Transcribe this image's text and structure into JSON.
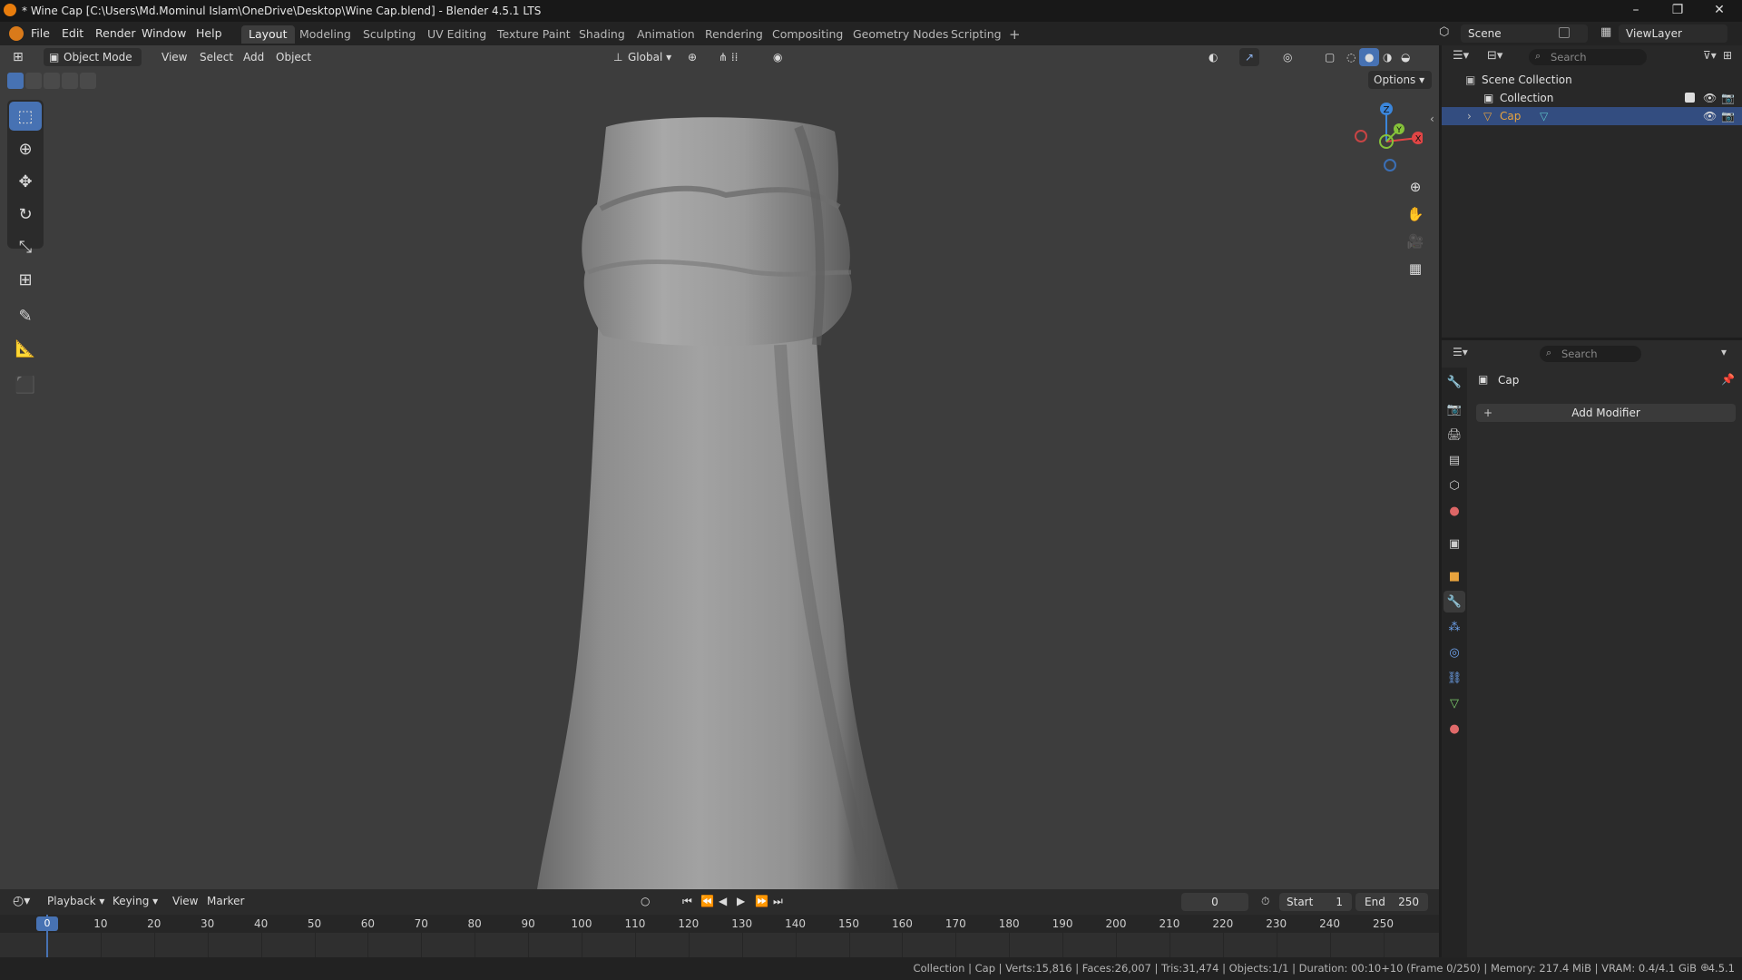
{
  "window": {
    "title": "* Wine Cap [C:\\Users\\Md.Mominul Islam\\OneDrive\\Desktop\\Wine Cap.blend] - Blender 4.5.1 LTS",
    "minimize": "–",
    "maximize": "❐",
    "close": "✕"
  },
  "menu": [
    "File",
    "Edit",
    "Render",
    "Window",
    "Help"
  ],
  "workspaces": [
    "Layout",
    "Modeling",
    "Sculpting",
    "UV Editing",
    "Texture Paint",
    "Shading",
    "Animation",
    "Rendering",
    "Compositing",
    "Geometry Nodes",
    "Scripting"
  ],
  "workspace_add": "+",
  "scene": {
    "label": "Scene",
    "view_layer": "ViewLayer"
  },
  "viewport": {
    "mode": "Object Mode",
    "menus": [
      "View",
      "Select",
      "Add",
      "Object"
    ],
    "orientation": "Global",
    "options": "Options",
    "gizmo": {
      "x": "X",
      "y": "Y",
      "z": "Z"
    }
  },
  "outliner": {
    "search_placeholder": "Search",
    "scene_collection": "Scene Collection",
    "collection": "Collection",
    "object": "Cap"
  },
  "properties": {
    "search_placeholder": "Search",
    "object_name": "Cap",
    "add_modifier": "Add Modifier"
  },
  "timeline": {
    "menus": [
      "Playback",
      "Keying",
      "View",
      "Marker"
    ],
    "current_frame": "0",
    "start_label": "Start",
    "start_value": "1",
    "end_label": "End",
    "end_value": "250",
    "ruler": [
      "0",
      "10",
      "20",
      "30",
      "40",
      "50",
      "60",
      "70",
      "80",
      "90",
      "100",
      "110",
      "120",
      "130",
      "140",
      "150",
      "160",
      "170",
      "180",
      "190",
      "200",
      "210",
      "220",
      "230",
      "240",
      "250"
    ]
  },
  "statusbar": {
    "text": "Collection | Cap | Verts:15,816 | Faces:26,007 | Tris:31,474 | Objects:1/1 | Duration: 00:10+10 (Frame 0/250) | Memory: 217.4 MiB | VRAM: 0.4/4.1 GiB",
    "version": "4.5.1"
  },
  "colors": {
    "accent": "#4772b3",
    "selected_row": "#334d80",
    "object_orange": "#e8a33d",
    "axis_x": "#e04545",
    "axis_y": "#85c23a",
    "axis_z": "#3b86db"
  }
}
